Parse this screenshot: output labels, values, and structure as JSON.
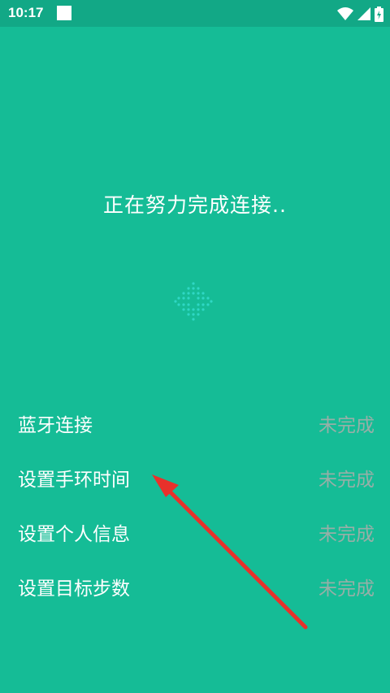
{
  "status_bar": {
    "time": "10:17",
    "icons": [
      "notification-icon",
      "wifi-icon",
      "signal-icon",
      "battery-icon"
    ]
  },
  "main": {
    "connecting_text": "正在努力完成连接.."
  },
  "steps": [
    {
      "label": "蓝牙连接",
      "status": "未完成"
    },
    {
      "label": "设置手环时间",
      "status": "未完成"
    },
    {
      "label": "设置个人信息",
      "status": "未完成"
    },
    {
      "label": "设置目标步数",
      "status": "未完成"
    }
  ],
  "colors": {
    "background": "#15BC96",
    "status_bar": "#12A886",
    "pending_status": "#97AFA7",
    "annotation_arrow": "#E8312B"
  }
}
